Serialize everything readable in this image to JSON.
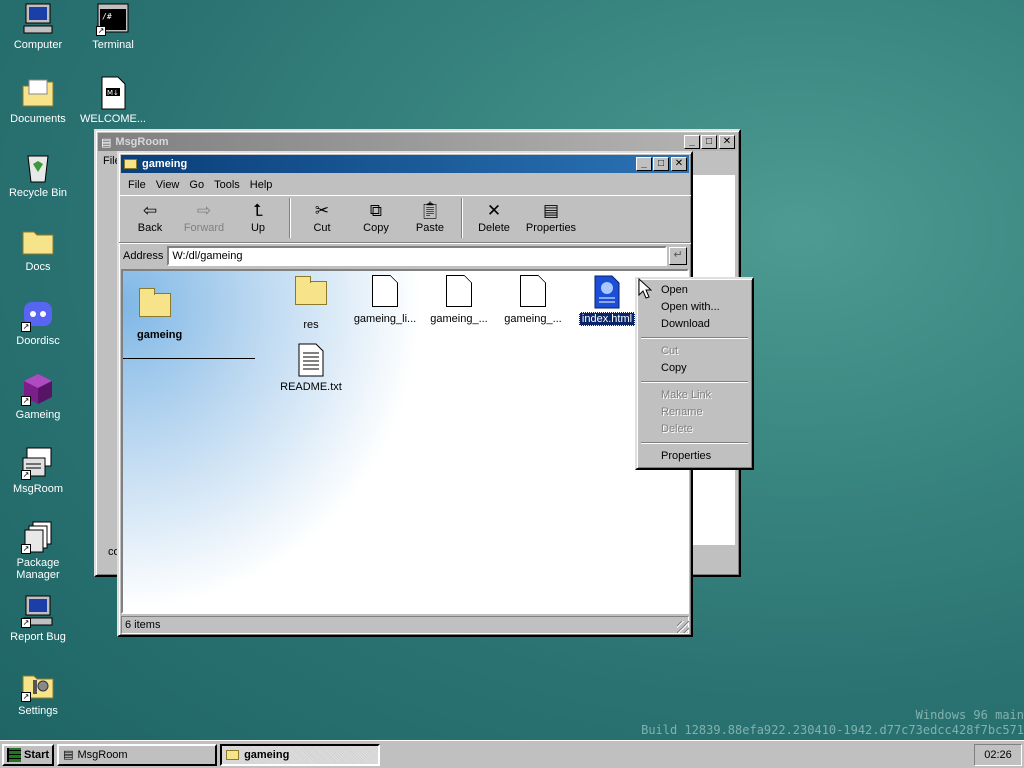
{
  "desktop_icons": [
    {
      "label": "Computer",
      "icon": "computer-icon"
    },
    {
      "label": "Terminal",
      "icon": "terminal-icon"
    },
    {
      "label": "Documents",
      "icon": "documents-folder-icon"
    },
    {
      "label": "WELCOME...",
      "icon": "markdown-file-icon"
    },
    {
      "label": "Recycle Bin",
      "icon": "recycle-bin-icon"
    },
    {
      "label": "Docs",
      "icon": "folder-icon"
    },
    {
      "label": "Doordisc",
      "icon": "discord-icon"
    },
    {
      "label": "Gameing",
      "icon": "cube-icon"
    },
    {
      "label": "MsgRoom",
      "icon": "msgroom-icon"
    },
    {
      "label": "Package Manager",
      "icon": "package-manager-icon"
    },
    {
      "label": "Report Bug",
      "icon": "report-bug-icon"
    },
    {
      "label": "Settings",
      "icon": "settings-icon"
    }
  ],
  "msgroom_window": {
    "title": "MsgRoom",
    "menu_partial": "File",
    "bottom_partial": "co"
  },
  "explorer": {
    "title": "gameing",
    "menu": [
      "File",
      "View",
      "Go",
      "Tools",
      "Help"
    ],
    "toolbar": {
      "back": "Back",
      "forward": "Forward",
      "up": "Up",
      "cut": "Cut",
      "copy": "Copy",
      "paste": "Paste",
      "delete": "Delete",
      "properties": "Properties"
    },
    "address_label": "Address",
    "address_value": "W:/dl/gameing",
    "sidebar_folder": "gameing",
    "files": [
      {
        "name": "res",
        "type": "folder"
      },
      {
        "name": "gameing_li...",
        "type": "file"
      },
      {
        "name": "gameing_...",
        "type": "file"
      },
      {
        "name": "gameing_...",
        "type": "file"
      },
      {
        "name": "index.html",
        "type": "html",
        "selected": true
      },
      {
        "name": "README.txt",
        "type": "text"
      }
    ],
    "status": "6 items"
  },
  "context_menu": {
    "items": [
      {
        "label": "Open",
        "enabled": true
      },
      {
        "label": "Open with...",
        "enabled": true
      },
      {
        "label": "Download",
        "enabled": true
      },
      {
        "label": "Cut",
        "enabled": false
      },
      {
        "label": "Copy",
        "enabled": true
      },
      {
        "label": "Make Link",
        "enabled": false
      },
      {
        "label": "Rename",
        "enabled": false
      },
      {
        "label": "Delete",
        "enabled": false
      },
      {
        "label": "Properties",
        "enabled": true
      }
    ]
  },
  "watermark": {
    "line1": "Windows 96 main",
    "line2": "Build 12839.88efa922.230410-1942.d77c73edcc428f7bc571"
  },
  "taskbar": {
    "start": "Start",
    "tasks": [
      {
        "label": "MsgRoom",
        "active": false
      },
      {
        "label": "gameing",
        "active": true
      }
    ],
    "clock": "02:26"
  }
}
